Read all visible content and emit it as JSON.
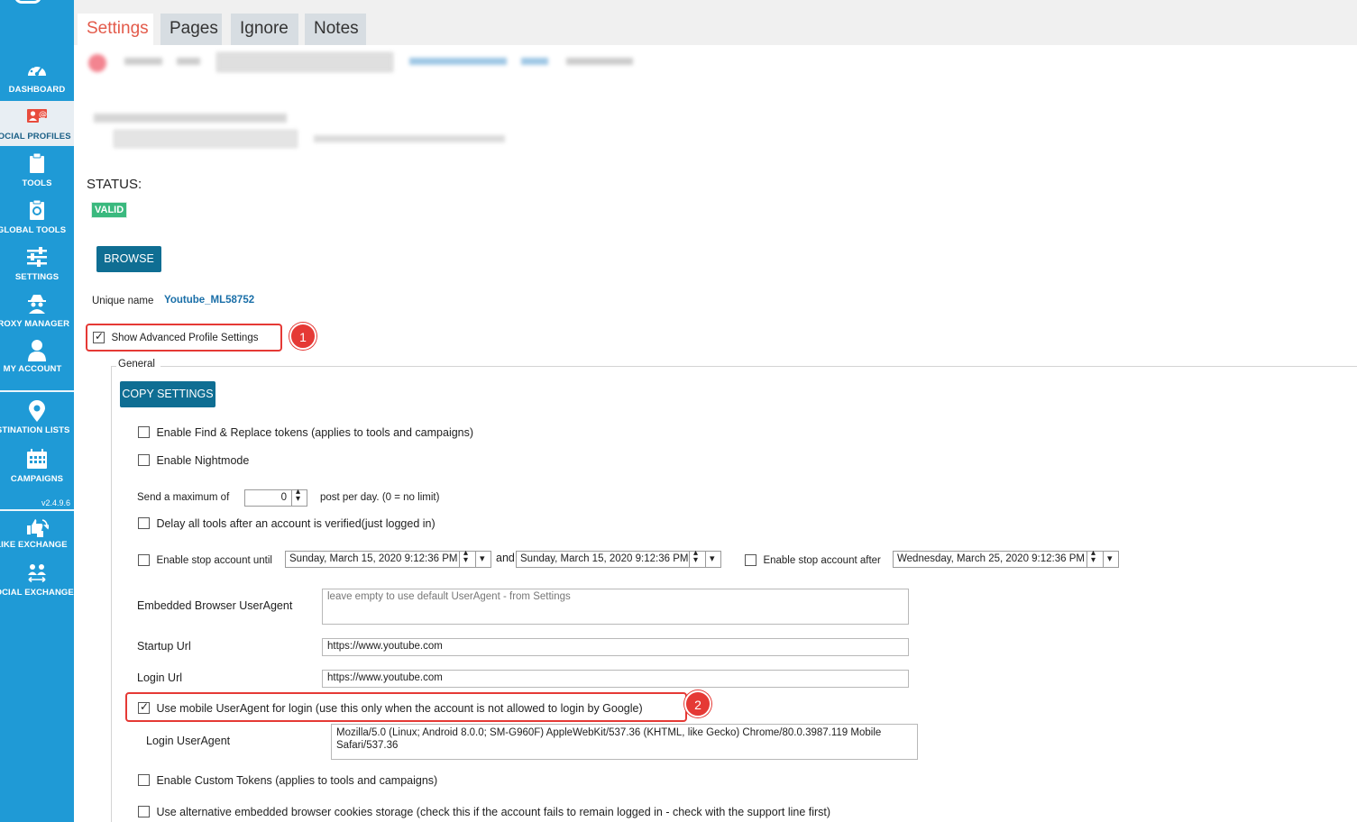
{
  "sidebar": {
    "items": [
      {
        "label": "DASHBOARD",
        "icon": "dashboard-icon"
      },
      {
        "label": "SOCIAL PROFILES",
        "icon": "social-profiles-icon"
      },
      {
        "label": "TOOLS",
        "icon": "clipboard-icon"
      },
      {
        "label": "GLOBAL TOOLS",
        "icon": "global-tools-icon"
      },
      {
        "label": "SETTINGS",
        "icon": "sliders-icon"
      },
      {
        "label": "PROXY MANAGER",
        "icon": "spy-icon"
      },
      {
        "label": "MY ACCOUNT",
        "icon": "user-icon"
      },
      {
        "label": "DESTINATION LISTS",
        "icon": "map-pin-icon"
      },
      {
        "label": "CAMPAIGNS",
        "icon": "calendar-icon"
      },
      {
        "label": "LIKE EXCHANGE",
        "icon": "like-exchange-icon"
      },
      {
        "label": "SOCIAL EXCHANGE",
        "icon": "social-exchange-icon"
      }
    ],
    "version": "v2.4.9.6"
  },
  "tabs": [
    "Settings",
    "Pages",
    "Ignore",
    "Notes"
  ],
  "status": {
    "label": "STATUS:",
    "badge": "VALID"
  },
  "browse_label": "BROWSE",
  "unique_name": {
    "label": "Unique name",
    "value": "Youtube_ML58752"
  },
  "advanced": {
    "label": "Show Advanced Profile Settings",
    "checked": true,
    "marker": "1"
  },
  "general": {
    "legend": "General",
    "copy_settings": "COPY SETTINGS",
    "find_replace": "Enable Find & Replace tokens (applies to tools and campaigns)",
    "nightmode": "Enable Nightmode",
    "send_max": {
      "prefix": "Send a maximum of",
      "value": "0",
      "suffix": "post per day. (0 = no limit)"
    },
    "delay_tools": "Delay all tools after an account is verified(just logged in)",
    "stop_until": {
      "label": "Enable stop account until",
      "from": "Sunday, March 15, 2020 9:12:36 PM",
      "and": "and",
      "to": "Sunday, March 15, 2020 9:12:36 PM"
    },
    "stop_after": {
      "label": "Enable stop account after",
      "date": "Wednesday, March 25, 2020 9:12:36 PM"
    },
    "embedded_ua": {
      "label": "Embedded Browser UserAgent",
      "placeholder": "leave empty to use default UserAgent - from Settings"
    },
    "startup_url": {
      "label": "Startup Url",
      "value": "https://www.youtube.com"
    },
    "login_url": {
      "label": "Login Url",
      "value": "https://www.youtube.com"
    },
    "mobile_ua": {
      "label": "Use mobile UserAgent for login (use this only when the account is not allowed to login by Google)",
      "checked": true,
      "marker": "2"
    },
    "login_ua": {
      "label": "Login UserAgent",
      "value": "Mozilla/5.0 (Linux; Android 8.0.0; SM-G960F) AppleWebKit/537.36 (KHTML, like Gecko) Chrome/80.0.3987.119 Mobile Safari/537.36"
    },
    "custom_tokens": "Enable Custom Tokens (applies to tools and campaigns)",
    "alt_cookies": "Use alternative embedded browser cookies storage (check this if the account fails to remain logged in - check with the support line first)"
  },
  "colors": {
    "sidebar": "#1f9ad6",
    "button": "#0f6e93",
    "valid": "#3ab97e",
    "marker": "#e53935",
    "link": "#1a7ab5",
    "active_tab": "#e35a4a"
  }
}
